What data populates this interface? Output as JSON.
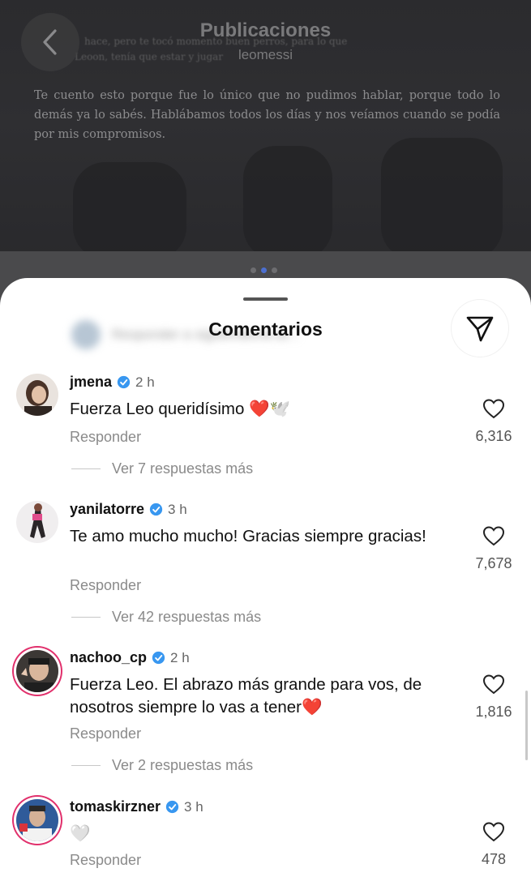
{
  "header": {
    "title": "Publicaciones",
    "username": "leomessi"
  },
  "post": {
    "caption": "Te cuento esto porque fue lo único que no pudimos hablar, porque todo lo demás ya lo sabés. Hablábamos todos los días y nos veíamos cuando se podía por mis compromisos.",
    "faint_lines": [
      "hace, pero te tocó momento buen perros, para lo que",
      "Leoon, tenía que estar y jugar"
    ]
  },
  "carousel": {
    "count": 3,
    "active": 1
  },
  "sheet": {
    "title": "Comentarios",
    "blurred_reply_hint": "Responder a siguiendome.ar..."
  },
  "comments": [
    {
      "username": "jmena",
      "time": "2 h",
      "text": "Fuerza Leo queridísimo ❤️🕊️",
      "reply_label": "Responder",
      "likes": "6,316",
      "more_replies": "Ver 7 respuestas más"
    },
    {
      "username": "yanilatorre",
      "time": "3 h",
      "text": "Te amo mucho mucho! Gracias siempre gracias!",
      "reply_label": "Responder",
      "likes": "7,678",
      "more_replies": "Ver 42 respuestas más"
    },
    {
      "username": "nachoo_cp",
      "time": "2 h",
      "text": "Fuerza Leo. El abrazo más grande para vos, de nosotros siempre lo vas a tener❤️",
      "reply_label": "Responder",
      "likes": "1,816",
      "more_replies": "Ver 2 respuestas más"
    },
    {
      "username": "tomaskirzner",
      "time": "3 h",
      "text": "🤍",
      "reply_label": "Responder",
      "likes": "478"
    }
  ],
  "colors": {
    "verified": "#3897f0",
    "story_ring": "#e1306c",
    "dot_active": "#4c6fd0"
  },
  "icons": {
    "back": "chevron-left-icon",
    "share": "send-icon",
    "like": "heart-outline-icon",
    "verified": "verified-badge-icon"
  }
}
